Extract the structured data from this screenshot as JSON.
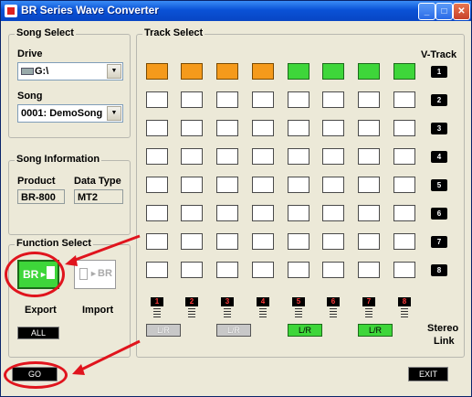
{
  "window": {
    "title": "BR Series Wave Converter",
    "minimize_glyph": "_",
    "maximize_glyph": "□",
    "close_glyph": "✕"
  },
  "song_select": {
    "group_label": "Song Select",
    "drive_label": "Drive",
    "drive_value": "G:\\",
    "song_label": "Song",
    "song_value": "0001: DemoSong"
  },
  "song_information": {
    "group_label": "Song Information",
    "product_label": "Product",
    "product_value": "BR-800",
    "data_type_label": "Data Type",
    "data_type_value": "MT2"
  },
  "function_select": {
    "group_label": "Function Select",
    "export_label": "Export",
    "import_label": "Import",
    "export_icon_text": "BR",
    "import_icon_text": "BR",
    "all_button": "ALL"
  },
  "track_select": {
    "group_label": "Track Select",
    "vtrack_header": "V-Track",
    "vtracks": [
      "1",
      "2",
      "3",
      "4",
      "5",
      "6",
      "7",
      "8"
    ],
    "tracks": [
      "1",
      "2",
      "3",
      "4",
      "5",
      "6",
      "7",
      "8"
    ],
    "selected_row": 1,
    "row1_colors": [
      "orange",
      "orange",
      "orange",
      "orange",
      "green",
      "green",
      "green",
      "green"
    ],
    "stereo_link_label_1": "Stereo",
    "stereo_link_label_2": "Link",
    "links": [
      {
        "label": "L/R",
        "state": "off"
      },
      {
        "label": "L/R",
        "state": "off"
      },
      {
        "label": "L/R",
        "state": "on"
      },
      {
        "label": "L/R",
        "state": "on"
      }
    ]
  },
  "buttons": {
    "go": "GO",
    "exit": "EXIT"
  },
  "colors": {
    "annotation": "#e0141d",
    "selected_orange": "#f59a1b",
    "selected_green": "#3ed63a"
  }
}
